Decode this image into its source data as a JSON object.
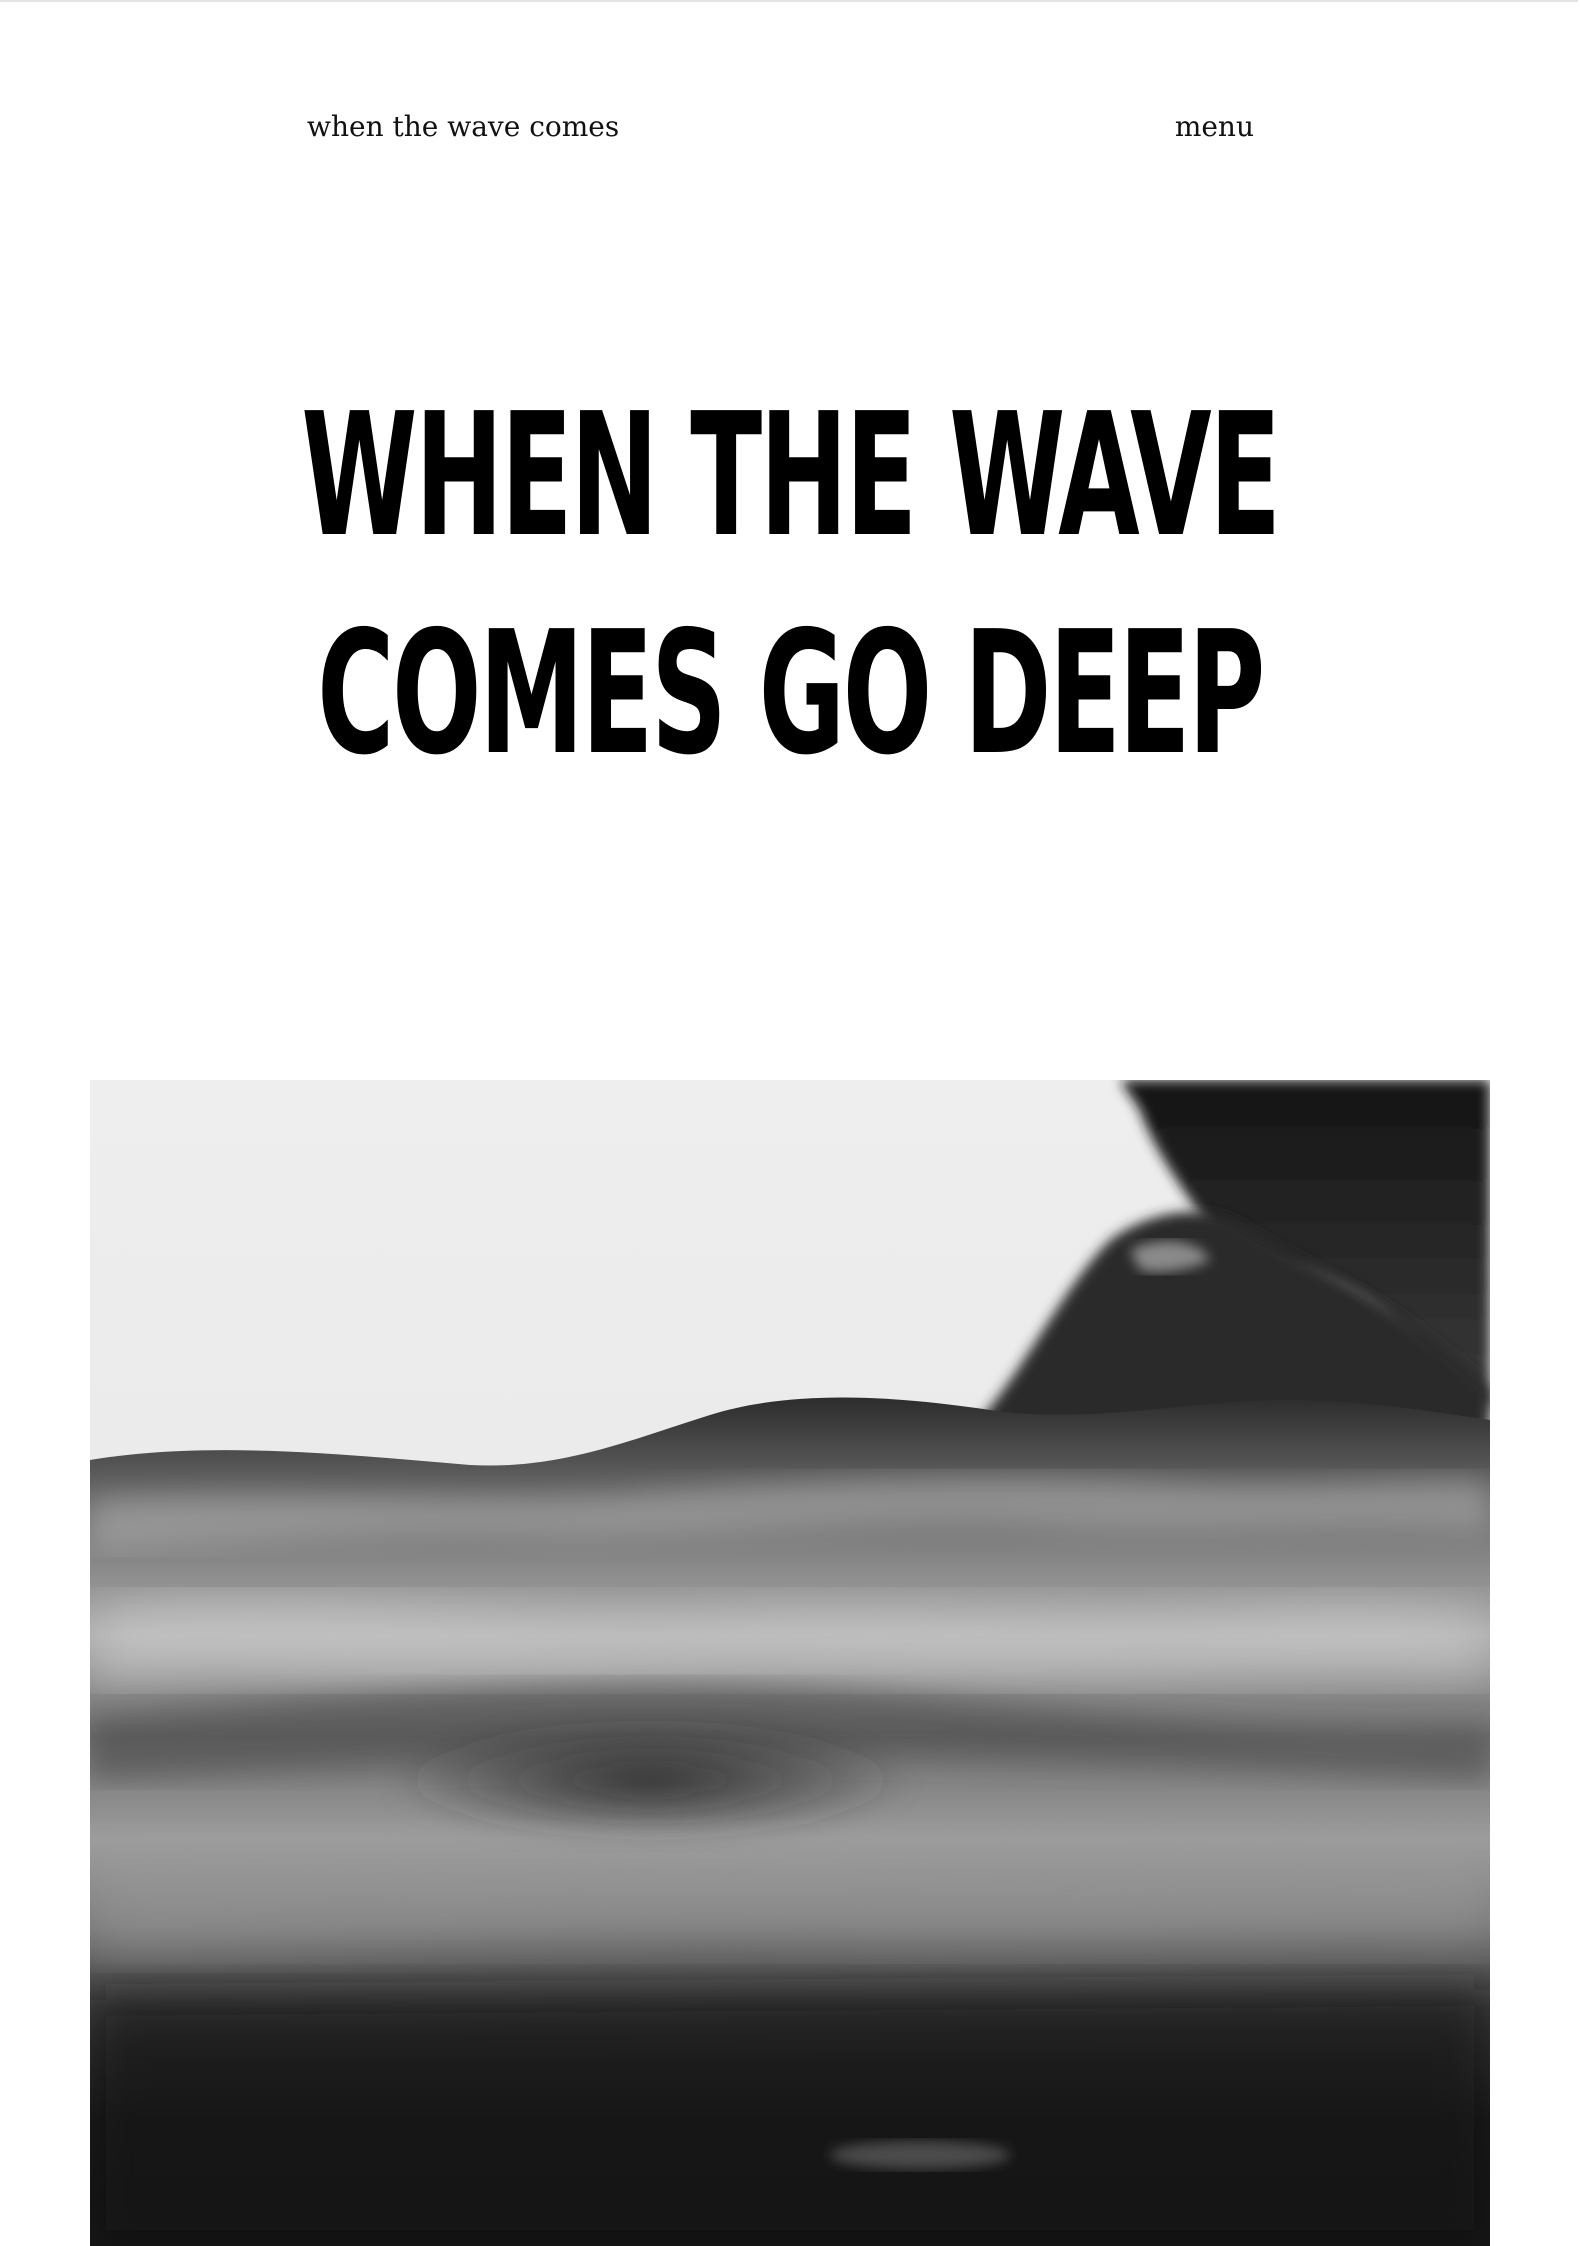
{
  "header": {
    "site_title": "when the wave comes",
    "menu_label": "menu"
  },
  "hero": {
    "headline_line1": "WHEN THE WAVE",
    "headline_line2": "COMES GO DEEP"
  },
  "image": {
    "subject": "black-and-white photo of ocean water surface with swimmer's head",
    "palette": [
      "#f0f0f0",
      "#d8d8d8",
      "#8a8a8a",
      "#3a3a3a",
      "#151515"
    ]
  }
}
